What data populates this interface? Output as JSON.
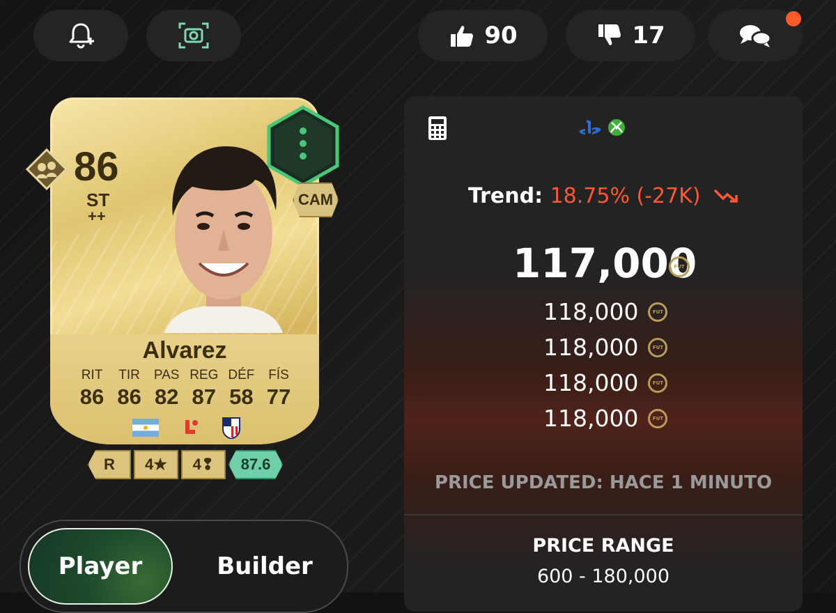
{
  "header": {
    "alert_icon": "bell-plus-icon",
    "screenshot_icon": "camera-scan-icon",
    "likes": "90",
    "dislikes": "17",
    "comments_icon": "chat-bubbles-icon"
  },
  "card": {
    "rating": "86",
    "position": "ST",
    "position_plus": "++",
    "alt_position": "CAM",
    "name": "Alvarez",
    "stat_labels": [
      "RIT",
      "TIR",
      "PAS",
      "REG",
      "DÉF",
      "FÍS"
    ],
    "stat_values": [
      "86",
      "86",
      "82",
      "87",
      "58",
      "77"
    ],
    "league_text": "LALIGA",
    "chips": {
      "foot": "R",
      "skill_moves": "4★",
      "weak_foot": "4❢",
      "chem_rating": "87.6"
    }
  },
  "toggle": {
    "player_label": "Player",
    "builder_label": "Builder"
  },
  "price": {
    "trend_label": "Trend:",
    "trend_value": "18.75% (-27K)",
    "main_price": "117,000",
    "coin_label": "FUT",
    "listings": [
      "118,000",
      "118,000",
      "118,000",
      "118,000"
    ],
    "updated": "PRICE UPDATED: HACE 1 MINUTO",
    "range_title": "PRICE RANGE",
    "range_value": "600 - 180,000"
  },
  "colors": {
    "accent_green": "#46c878",
    "trend_red": "#ff5733",
    "notif_dot": "#ff5a2a",
    "card_gold": "#e0c571"
  }
}
